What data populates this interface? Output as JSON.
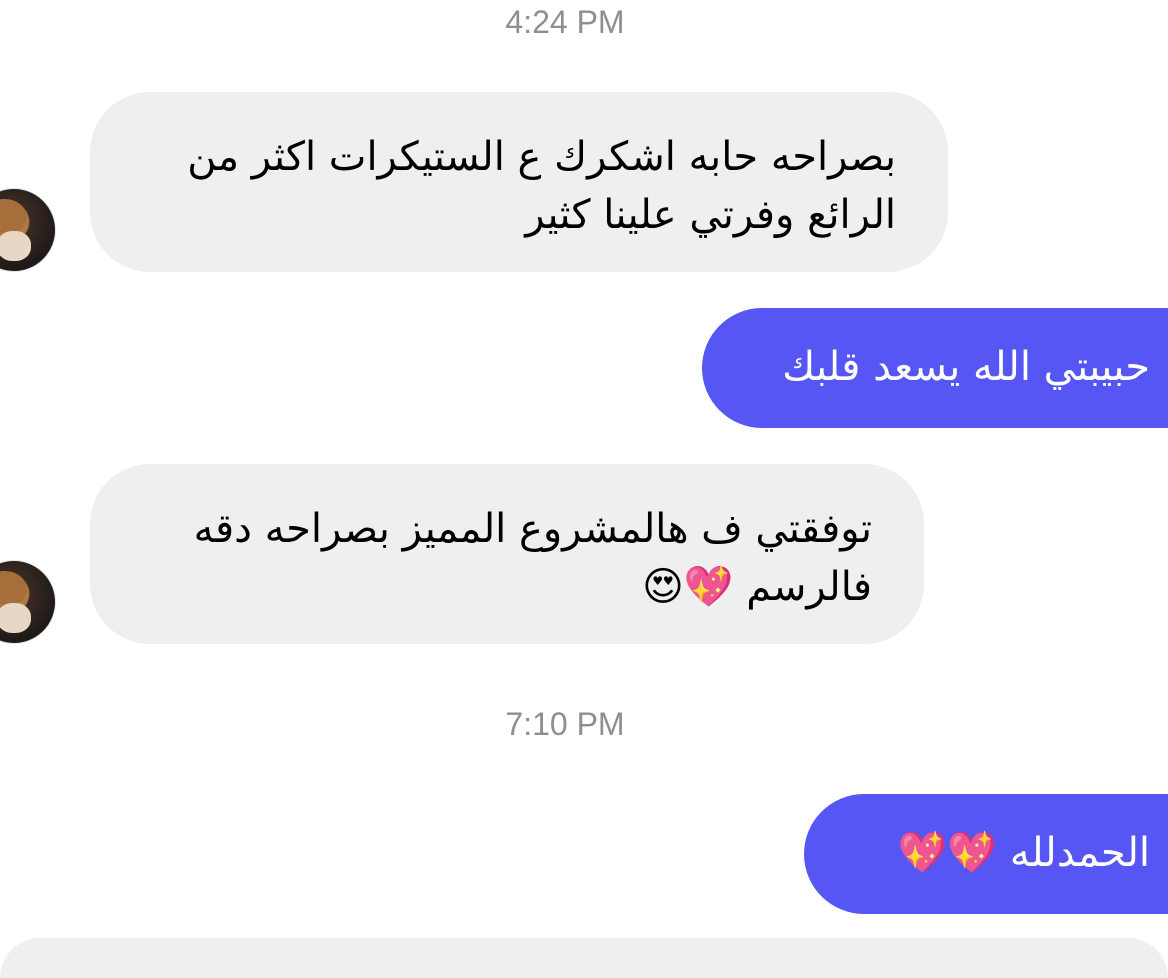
{
  "timestamps": [
    "4:24 PM",
    "7:10 PM"
  ],
  "messages": [
    {
      "side": "incoming",
      "lines": [
        "بصراحه حابه اشكرك ع الستيكرات اكثر من",
        "الرائع  وفرتي علينا كثير"
      ]
    },
    {
      "side": "outgoing",
      "lines": [
        "حبيبتي الله يسعد قلبك"
      ]
    },
    {
      "side": "incoming",
      "lines": [
        "توفقتي ف هالمشروع المميز بصراحه دقه",
        "فالرسم 💖😍"
      ]
    },
    {
      "side": "outgoing",
      "lines": [
        "الحمدلله 💖💖"
      ]
    }
  ],
  "colors": {
    "incoming_bubble": "#efefef",
    "outgoing_bubble": "#5656f5",
    "timestamp_text": "#8e8e93"
  },
  "icons": {
    "avatar": "contact-avatar",
    "emojis": [
      "sparkling-heart-icon",
      "heart-eyes-icon"
    ]
  }
}
